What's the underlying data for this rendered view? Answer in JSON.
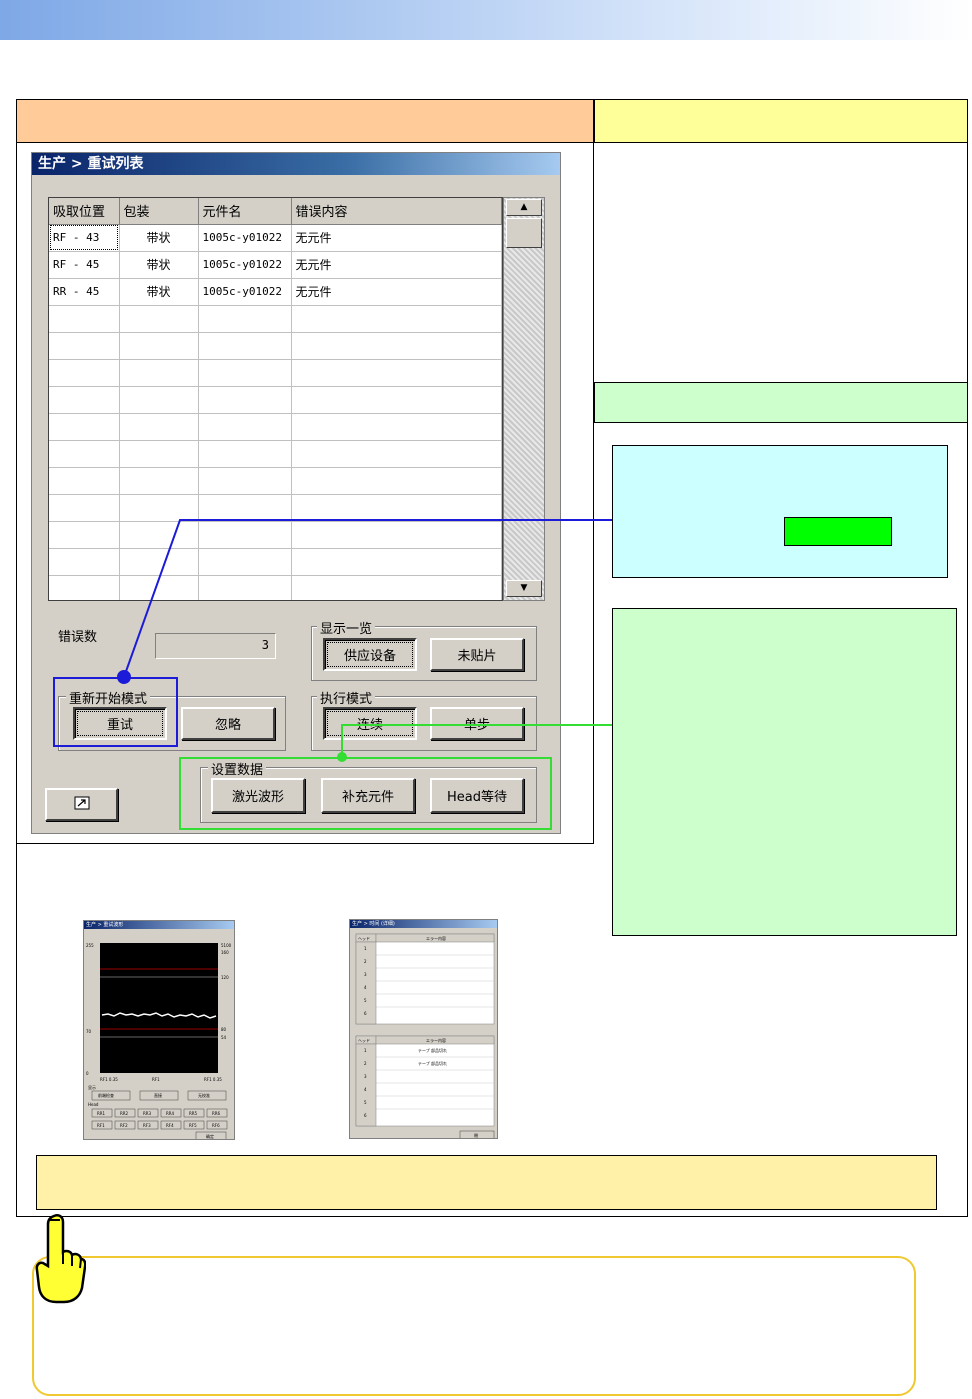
{
  "window": {
    "title": "生产 > 重试列表",
    "columns": [
      "吸取位置",
      "包装",
      "元件名",
      "错误内容"
    ],
    "rows": [
      {
        "pos": "RF - 43",
        "pack": "带状",
        "part": "1005c-y01022",
        "error": "无元件"
      },
      {
        "pos": "RF - 45",
        "pack": "带状",
        "part": "1005c-y01022",
        "error": "无元件"
      },
      {
        "pos": "RR - 45",
        "pack": "带状",
        "part": "1005c-y01022",
        "error": "无元件"
      }
    ],
    "empty_row_count": 11,
    "error_count_label": "错误数",
    "error_count_value": "3",
    "display_group": {
      "label": "显示一览",
      "feeder_btn": "供应设备",
      "unmounted_btn": "未贴片"
    },
    "restart_group": {
      "label": "重新开始模式",
      "retry_btn": "重试",
      "ignore_btn": "忽略"
    },
    "exec_group": {
      "label": "执行模式",
      "continuous_btn": "连续",
      "step_btn": "单步"
    },
    "settings_group": {
      "label": "设置数据",
      "laser_btn": "激光波形",
      "supplement_btn": "补充元件",
      "head_wait_btn": "Head等待"
    },
    "restore_icon": "restore-window-icon"
  },
  "thumb1": {
    "title": "生产 > 重试波形",
    "y_top": "255",
    "y_mid": "70",
    "y_bottom": "0",
    "right_ticks": [
      "5100",
      "160",
      "120",
      "80",
      "54"
    ],
    "x_ticks": [
      "RF1 0.35",
      "RF1",
      "RF1 0.35"
    ],
    "display_label": "显示",
    "btns1": [
      "前端检查",
      "直接",
      "无校准"
    ],
    "head_label": "Head",
    "btns2": [
      "RR1",
      "RR2",
      "RR3",
      "RR4",
      "RR5",
      "RR6"
    ],
    "btns3": [
      "RF1",
      "RF2",
      "RF3",
      "RF4",
      "RF5",
      "RF6"
    ],
    "close_btn": "确定"
  },
  "thumb2": {
    "title": "生产 > 时间 (详细)",
    "col_head": "ヘッド",
    "col_err": "エラー内容",
    "rows_top": [
      "1",
      "2",
      "3",
      "4",
      "5",
      "6"
    ],
    "rows_bottom": [
      "1",
      "2",
      "3",
      "4",
      "5",
      "6"
    ],
    "err_texts": [
      "テープ 部品切れ",
      "テープ 部品切れ"
    ],
    "close_btn": "閉"
  },
  "colors": {
    "orange_header": "#ffcc99",
    "yellow_header": "#ffff99",
    "green_header": "#ccffcc",
    "cyan_box": "#ccffff",
    "callout_blue": "#1c1cd8",
    "callout_green": "#33dd33"
  }
}
